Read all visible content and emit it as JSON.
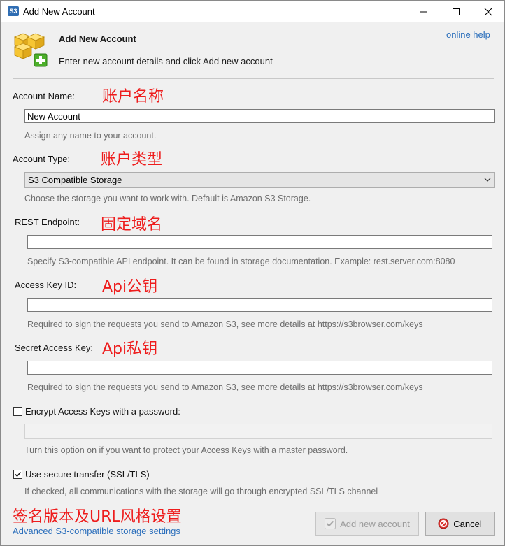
{
  "window": {
    "title": "Add New Account",
    "app_icon_text": "S3",
    "controls": [
      "minimize",
      "maximize",
      "close"
    ]
  },
  "header": {
    "title": "Add New Account",
    "subtitle": "Enter new account details and click Add new account",
    "help_link": "online help",
    "icon": "cubes-add-icon"
  },
  "account_name": {
    "label": "Account Name:",
    "annotation": "账户名称",
    "value": "New Account",
    "hint": "Assign any name to your account."
  },
  "account_type": {
    "label": "Account Type:",
    "annotation": "账户类型",
    "selected": "S3 Compatible Storage",
    "hint": "Choose the storage you want to work with. Default is Amazon S3 Storage."
  },
  "rest_endpoint": {
    "label": "REST Endpoint:",
    "annotation": "固定域名",
    "value": "",
    "hint": "Specify S3-compatible API endpoint. It can be found in storage documentation. Example: rest.server.com:8080"
  },
  "access_key": {
    "label": "Access Key ID:",
    "annotation": "Api公钥",
    "value": "",
    "hint": "Required to sign the requests you send to Amazon S3, see more details at https://s3browser.com/keys"
  },
  "secret_key": {
    "label": "Secret Access Key:",
    "annotation": "Api私钥",
    "value": "",
    "hint": "Required to sign the requests you send to Amazon S3, see more details at https://s3browser.com/keys"
  },
  "encrypt": {
    "label": "Encrypt Access Keys with a password:",
    "checked": false,
    "value": "",
    "hint": "Turn this option on if you want to protect your Access Keys with a master password."
  },
  "secure": {
    "label": "Use secure transfer (SSL/TLS)",
    "checked": true,
    "hint": "If checked, all communications with the storage will go through encrypted SSL/TLS channel"
  },
  "advanced": {
    "annotation": "签名版本及URL风格设置",
    "link": "Advanced S3-compatible storage settings"
  },
  "buttons": {
    "add": "Add new account",
    "cancel": "Cancel"
  },
  "colors": {
    "annotation": "#ee1c1c",
    "link": "#2a6ebb",
    "hint": "#6d6d6d"
  }
}
